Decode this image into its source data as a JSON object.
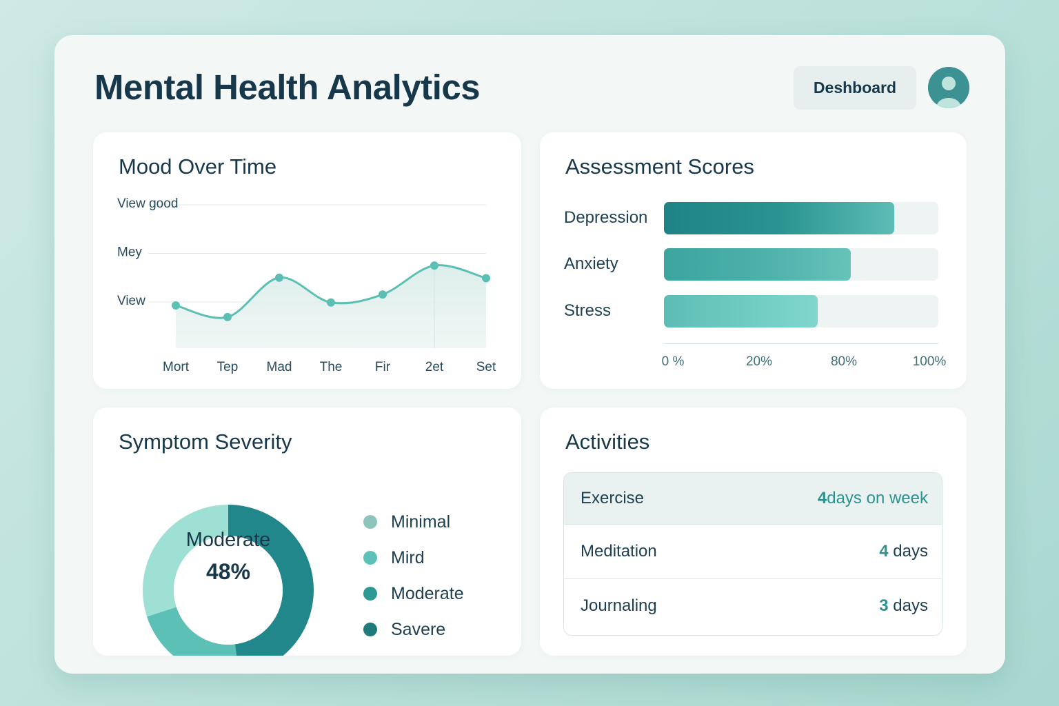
{
  "header": {
    "title": "Mental Health Analytics",
    "dashboard_button": "Deshboard"
  },
  "colors": {
    "accent": "#2a9390",
    "dark_teal": "#22878a",
    "teal": "#4fb5ae",
    "light_teal": "#7fd3c8",
    "mint": "#9ee0d3",
    "text": "#17384b"
  },
  "mood_card": {
    "title": "Mood Over Time"
  },
  "scores_card": {
    "title": "Assessment Scores"
  },
  "severity_card": {
    "title": "Symptom Severity",
    "center_label": "Moderate",
    "center_value": "48%"
  },
  "activities_card": {
    "title": "Activities",
    "rows": [
      {
        "name": "Exercise",
        "value_num": "4",
        "value_text": "days on week"
      },
      {
        "name": "Meditation",
        "value_num": "4",
        "value_text": " days"
      },
      {
        "name": "Journaling",
        "value_num": "3",
        "value_text": " days"
      }
    ]
  },
  "chart_data": [
    {
      "type": "area",
      "title": "Mood Over Time",
      "categories": [
        "Mort",
        "Tep",
        "Mad",
        "The",
        "Fir",
        "2et",
        "Set"
      ],
      "y_tick_labels": [
        "View good",
        "Mey",
        "View"
      ],
      "y_tick_values": [
        5,
        3,
        1
      ],
      "ylim": [
        -0.9,
        5
      ],
      "values": [
        0.86,
        0.38,
        2.0,
        0.98,
        1.31,
        2.5,
        1.98
      ],
      "grid": true,
      "grid_x_at": "2et"
    },
    {
      "type": "bar",
      "orientation": "horizontal",
      "title": "Assessment Scores",
      "categories": [
        "Depression",
        "Anxiety",
        "Stress"
      ],
      "values": [
        84,
        68,
        56
      ],
      "x_tick_labels": [
        "0 %",
        "20%",
        "80%",
        "100%"
      ],
      "xlim": [
        0,
        100
      ]
    },
    {
      "type": "pie",
      "style": "donut",
      "title": "Symptom Severity",
      "labels": [
        "Minimal",
        "Mird",
        "Moderate",
        "Savere"
      ],
      "legend_colors": [
        "#8fc4bd",
        "#5ec1b7",
        "#2e9893",
        "#1f7a7c"
      ],
      "slice_values": [
        48,
        22,
        30
      ],
      "slice_colors": [
        "#22878a",
        "#5cc0b6",
        "#9ee0d3"
      ],
      "center_label": "Moderate",
      "center_value": "48%"
    }
  ]
}
